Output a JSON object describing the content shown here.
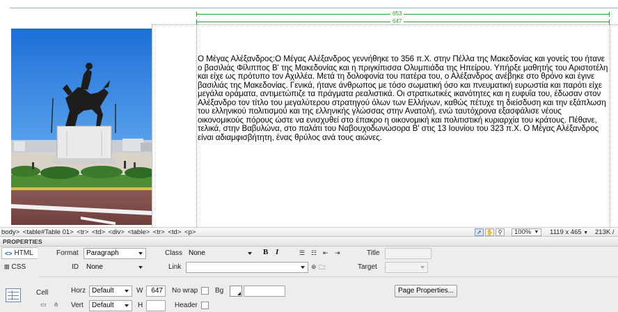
{
  "design": {
    "ruler_table_width": "653",
    "ruler_cell_width": "647",
    "article_text": "Ο Μέγας Αλέξανδρος:Ο Μέγας Αλέξανδρος γεννήθηκε το 356 π.Χ. στην Πέλλα της Μακεδονίας και γονείς του ήτανε ο βασιλιάς Φίλιππος Β' της Μακεδονίας και η πριγκίπισσα Ολυμπιάδα της Ηπείρου. Υπήρξε μαθητής του Αριστοτέλη και είχε ως πρότυπο τον Αχιλλέα. Μετά τη δολοφονία του πατέρα του, ο Αλέξανδρος ανέβηκε στο θρόνο και έγινε βασιλιάς της Μακεδονίας. Γενικά, ήτανε άνθρωπος με τόσο σωματική όσο και πνευματική ευρωστία και παρότι είχε μεγάλα οράματα, αντιμετώπιζε τα πράγματα ρεαλιστικά. Οι στρατιωτικές ικανότητες και η ευφυΐα του, έδωσαν στον Αλέξανδρο τον τίτλο του μεγαλύτερου στρατηγού όλων των Ελλήνων, καθώς πέτυχε τη διείσδυση και την εξάπλωση του ελληνικού πολιτισμού και της ελληνικής γλώσσας στην Ανατολή, ενώ ταυτόχρονα εξασφάλισε νέους οικονομικούς πόρους ώστε να ενισχυθεί στο έπακρο η οικονομική και πολιτιστική κυριαρχία του κράτους. Πέθανε, τελικά, στην Βαβυλώνα, στο παλάτι του Ναβουχοδωνώσορα Β' στις 13 Ιουνίου του 323 π.Χ. Ο Μέγας Αλέξανδρος είναι αδιαμφισβήτητη, ένας θρύλος ανά τους αιώνες."
  },
  "statusbar": {
    "tags": [
      "body>",
      "<table#Table 01>",
      "<tr>",
      "<td>",
      "<div>",
      "<table>",
      "<tr>",
      "<td>",
      "<p>"
    ],
    "zoom": "100%",
    "window_size": "1119 x 465",
    "download_size": "213K /"
  },
  "properties": {
    "title": "PROPERTIES",
    "tab_html": "HTML",
    "tab_css": "CSS",
    "format_label": "Format",
    "format_value": "Paragraph",
    "class_label": "Class",
    "class_value": "None",
    "id_label": "ID",
    "id_value": "None",
    "link_label": "Link",
    "link_value": "",
    "bold_label": "B",
    "italic_label": "I",
    "title_label": "Title",
    "title_value": "",
    "target_label": "Target",
    "target_value": "",
    "cell_label": "Cell",
    "horz_label": "Horz",
    "horz_value": "Default",
    "vert_label": "Vert",
    "vert_value": "Default",
    "w_label": "W",
    "w_value": "647",
    "h_label": "H",
    "h_value": "",
    "nowrap_label": "No wrap",
    "header_label": "Header",
    "bg_label": "Bg",
    "bg_value": "",
    "page_properties_label": "Page Properties..."
  },
  "colors": {
    "ruler": "#27a627",
    "panel_bg": "#ededed",
    "accent_blue": "#2255aa"
  }
}
